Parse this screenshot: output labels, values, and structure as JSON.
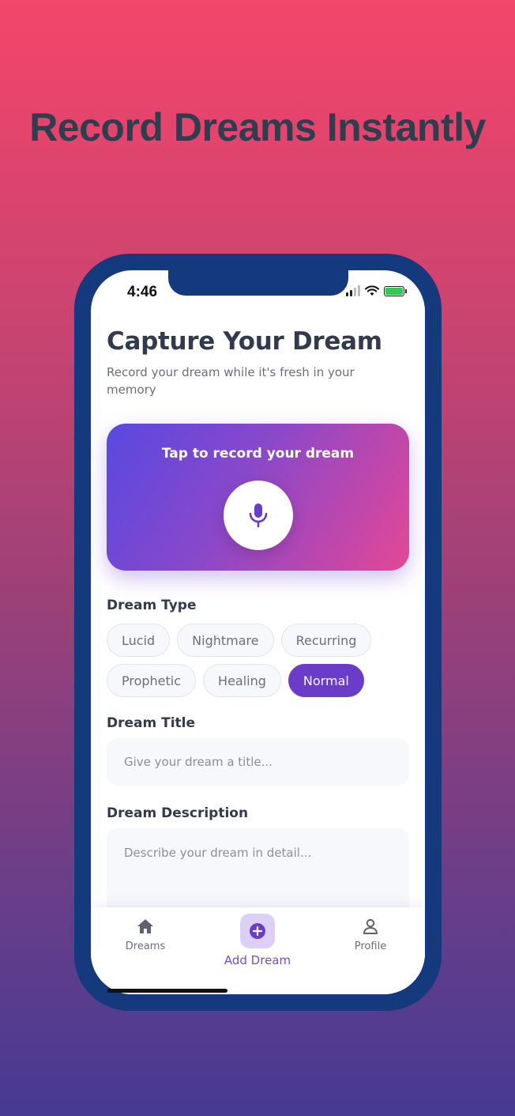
{
  "promo": {
    "headline": "Record Dreams Instantly"
  },
  "status_bar": {
    "time": "4:46"
  },
  "screen": {
    "title": "Capture Your Dream",
    "subtitle": "Record your dream while it's fresh in your memory"
  },
  "record": {
    "label": "Tap to record your dream",
    "icon": "microphone-icon"
  },
  "dream_type": {
    "label": "Dream Type",
    "options": [
      "Lucid",
      "Nightmare",
      "Recurring",
      "Prophetic",
      "Healing",
      "Normal"
    ],
    "selected": "Normal"
  },
  "dream_title": {
    "label": "Dream Title",
    "placeholder": "Give your dream a title..."
  },
  "dream_description": {
    "label": "Dream Description",
    "placeholder": "Describe your dream in detail..."
  },
  "bottom_nav": {
    "items": [
      {
        "label": "Dreams",
        "icon": "home-icon"
      },
      {
        "label": "Add Dream",
        "icon": "plus-circle-icon"
      },
      {
        "label": "Profile",
        "icon": "person-icon"
      }
    ],
    "active": "Add Dream"
  },
  "colors": {
    "accent": "#6b3cc8",
    "card_gradient_start": "#5849e0",
    "card_gradient_end": "#e44894",
    "frame": "#15397d",
    "heading": "#333a4d"
  }
}
